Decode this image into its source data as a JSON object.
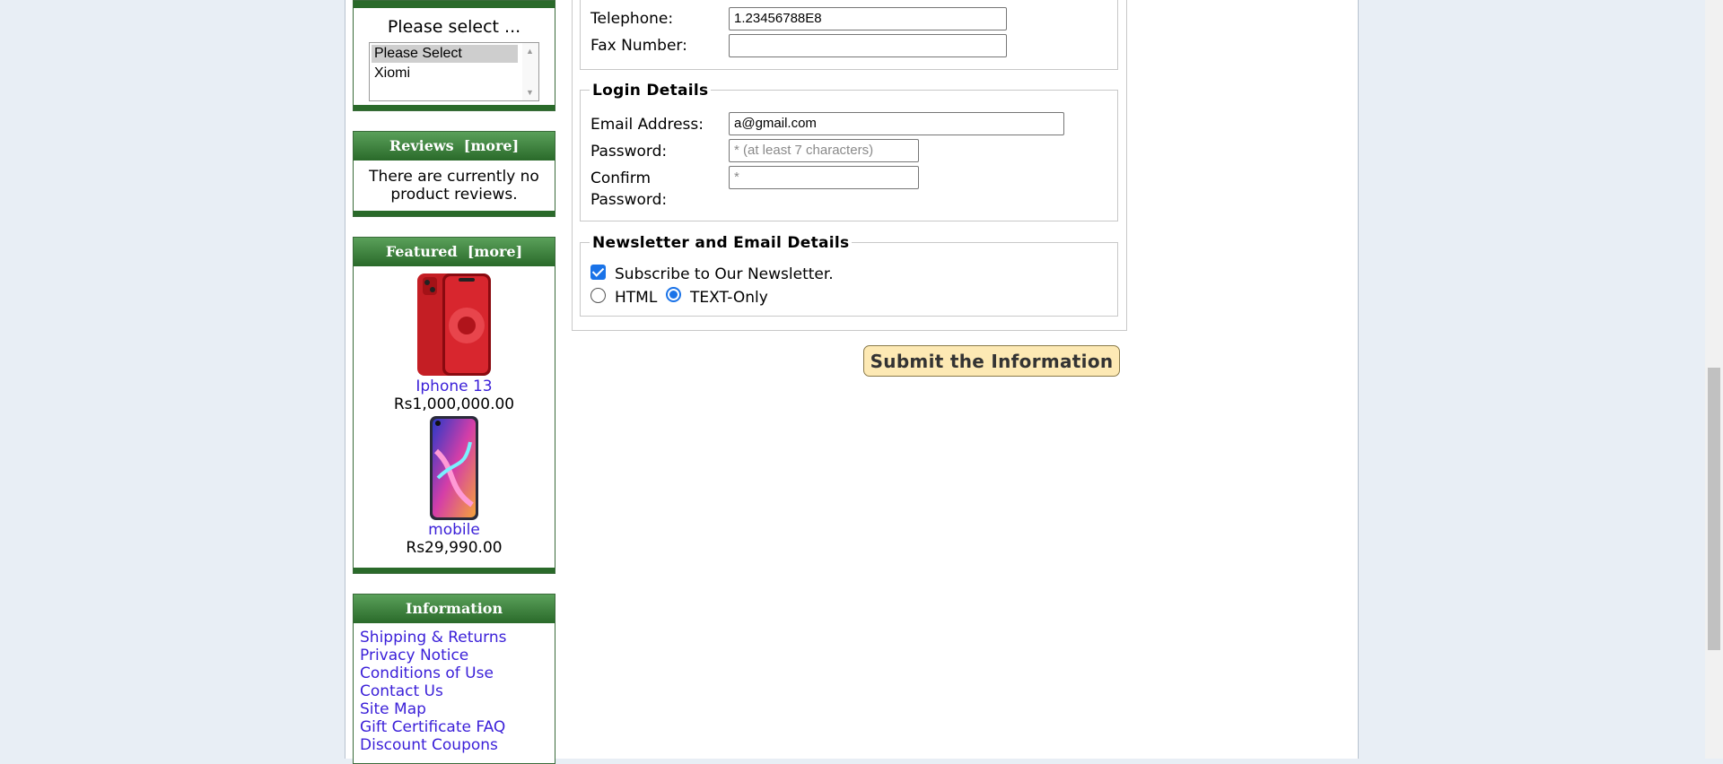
{
  "sidebar": {
    "manufacturers": {
      "title": "Please select ...",
      "options": [
        "Please Select",
        "Xiomi"
      ],
      "selected": "Please Select"
    },
    "reviews": {
      "title": "Reviews",
      "more": "[more]",
      "body_line1": "There are currently no",
      "body_line2": "product reviews."
    },
    "featured": {
      "title": "Featured",
      "more": "[more]",
      "products": [
        {
          "name": "Iphone 13",
          "price": "Rs1,000,000.00"
        },
        {
          "name": "mobile",
          "price": "Rs29,990.00"
        }
      ]
    },
    "information": {
      "title": "Information",
      "links": [
        "Shipping & Returns",
        "Privacy Notice",
        "Conditions of Use",
        "Contact Us",
        "Site Map",
        "Gift Certificate FAQ",
        "Discount Coupons"
      ]
    }
  },
  "form": {
    "contact": {
      "telephone_label": "Telephone:",
      "telephone_value": "1.23456788E8",
      "fax_label": "Fax Number:",
      "fax_value": ""
    },
    "login": {
      "legend": "Login Details",
      "email_label": "Email Address:",
      "email_value": "a@gmail.com",
      "password_label": "Password:",
      "password_placeholder": "* (at least 7 characters)",
      "confirm_label_line1": "Confirm",
      "confirm_label_line2": "Password:",
      "confirm_placeholder": "*"
    },
    "newsletter": {
      "legend": "Newsletter and Email Details",
      "subscribe_label": "Subscribe to Our Newsletter.",
      "subscribe_checked": true,
      "format_html": "HTML",
      "format_text": "TEXT-Only",
      "format_selected": "TEXT-Only"
    },
    "submit_label": "Submit the Information"
  }
}
